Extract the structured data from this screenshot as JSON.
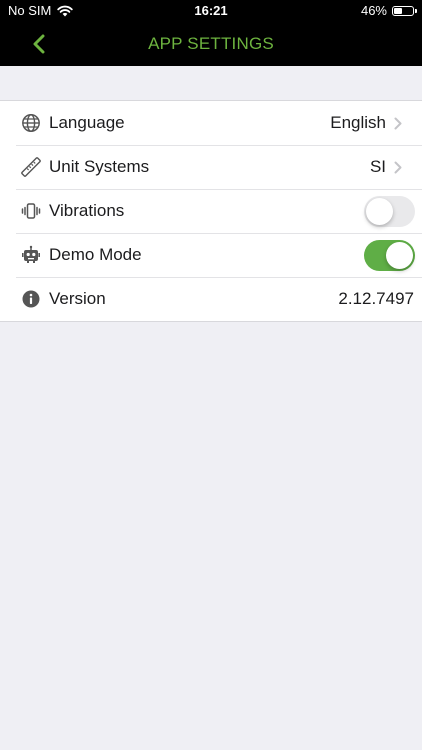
{
  "status_bar": {
    "carrier": "No SIM",
    "time": "16:21",
    "battery": "46%",
    "battery_level": 0.46
  },
  "nav": {
    "title": "APP SETTINGS",
    "accent_color": "#6db33f"
  },
  "settings": {
    "language": {
      "label": "Language",
      "value": "English",
      "icon": "globe-icon"
    },
    "units": {
      "label": "Unit Systems",
      "value": "SI",
      "icon": "ruler-icon"
    },
    "vibrations": {
      "label": "Vibrations",
      "enabled": false,
      "icon": "vibration-icon"
    },
    "demo": {
      "label": "Demo Mode",
      "enabled": true,
      "icon": "robot-icon"
    },
    "version": {
      "label": "Version",
      "value": "2.12.7497",
      "icon": "info-icon"
    }
  },
  "colors": {
    "toggle_on": "#5fae46",
    "toggle_off": "#e9e9eb",
    "background": "#efeff4"
  }
}
